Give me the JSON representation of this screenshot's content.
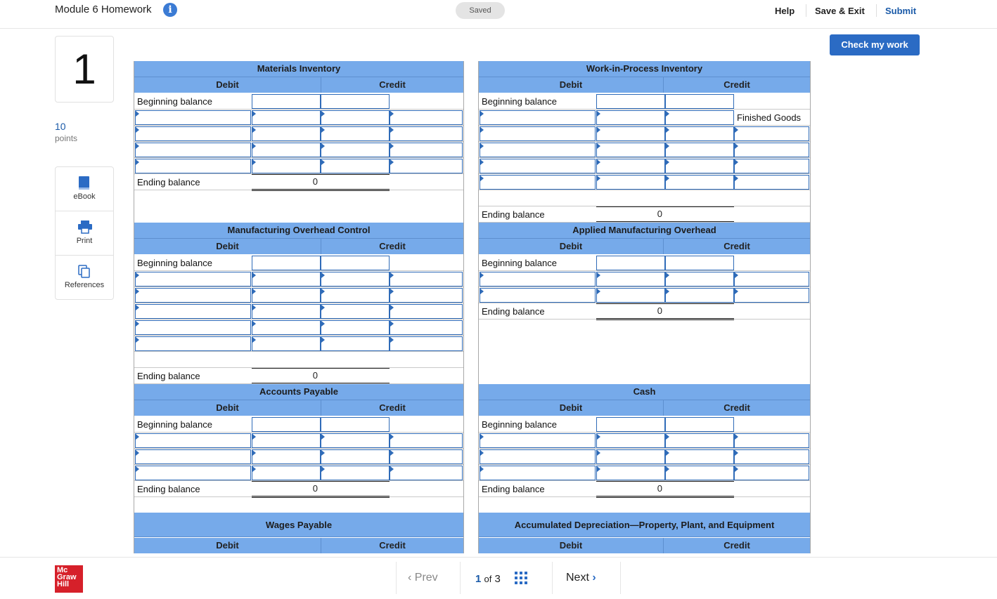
{
  "header": {
    "title": "Module 6 Homework",
    "saved": "Saved",
    "help": "Help",
    "save_exit": "Save & Exit",
    "submit": "Submit",
    "check": "Check my work"
  },
  "question": {
    "number": "1",
    "points_value": "10",
    "points_label": "points"
  },
  "tools": [
    {
      "label": "eBook",
      "icon": "book-icon"
    },
    {
      "label": "Print",
      "icon": "printer-icon"
    },
    {
      "label": "References",
      "icon": "copy-icon"
    }
  ],
  "accounts": [
    {
      "title": "Materials Inventory",
      "debit": "Debit",
      "credit": "Credit",
      "begin": "Beginning balance",
      "end": "Ending balance",
      "ending_value": "0",
      "credit_note": ""
    },
    {
      "title": "Work-in-Process Inventory",
      "debit": "Debit",
      "credit": "Credit",
      "begin": "Beginning balance",
      "end": "Ending balance",
      "ending_value": "0",
      "credit_note": "Finished Goods"
    },
    {
      "title": "Manufacturing Overhead Control",
      "debit": "Debit",
      "credit": "Credit",
      "begin": "Beginning balance",
      "end": "Ending balance",
      "ending_value": "0",
      "credit_note": ""
    },
    {
      "title": "Applied Manufacturing Overhead",
      "debit": "Debit",
      "credit": "Credit",
      "begin": "Beginning balance",
      "end": "Ending balance",
      "ending_value": "0",
      "credit_note": ""
    },
    {
      "title": "Accounts Payable",
      "debit": "Debit",
      "credit": "Credit",
      "begin": "Beginning balance",
      "end": "Ending balance",
      "ending_value": "0",
      "credit_note": ""
    },
    {
      "title": "Cash",
      "debit": "Debit",
      "credit": "Credit",
      "begin": "Beginning balance",
      "end": "Ending balance",
      "ending_value": "0",
      "credit_note": ""
    },
    {
      "title": "Wages Payable",
      "debit": "Debit",
      "credit": "Credit"
    },
    {
      "title": "Accumulated Depreciation—Property, Plant, and Equipment",
      "debit": "Debit",
      "credit": "Credit"
    }
  ],
  "footer": {
    "logo": "Mc Graw Hill",
    "prev": "Prev",
    "page_current": "1",
    "page_of": "of",
    "page_total": "3",
    "next": "Next"
  },
  "colors": {
    "accent": "#2b6bc4",
    "table_header": "#76aaea",
    "logo": "#d6202a"
  }
}
